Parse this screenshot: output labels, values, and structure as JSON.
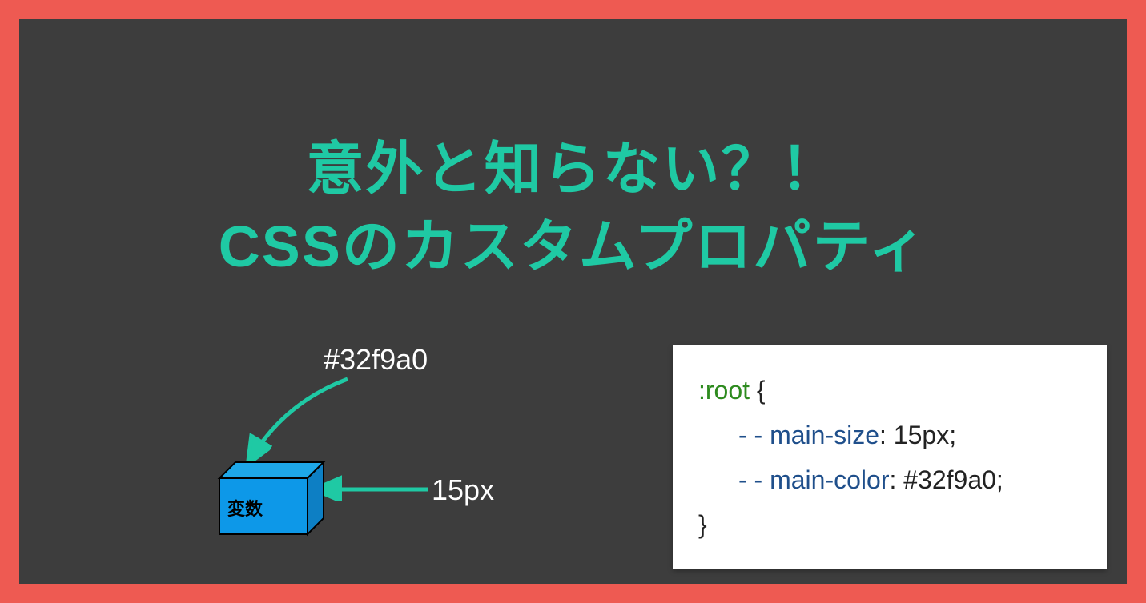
{
  "title_line1": "意外と知らない？！",
  "title_line2": "CSSのカスタムプロパティ",
  "diagram": {
    "hex_value": "#32f9a0",
    "px_value": "15px",
    "box_label": "変数"
  },
  "code": {
    "selector": ":root",
    "open": " {",
    "close": "}",
    "lines": [
      {
        "prop": "- - main-size",
        "value": "15px"
      },
      {
        "prop": "- - main-color",
        "value": "#32f9a0"
      }
    ]
  }
}
